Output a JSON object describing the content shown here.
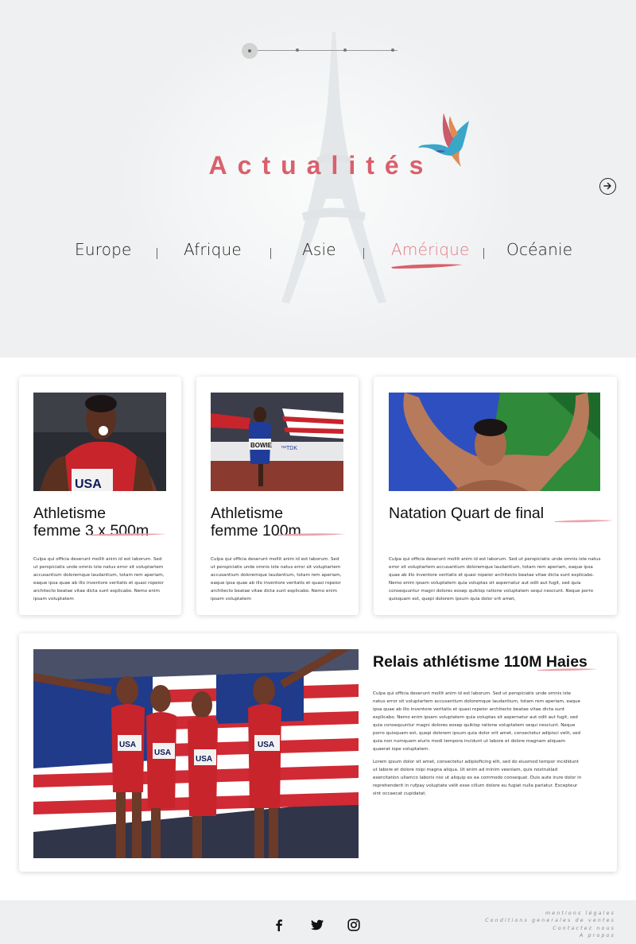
{
  "hero": {
    "title": "Actualités",
    "regions": [
      {
        "label": "Europe",
        "active": false
      },
      {
        "label": "Afrique",
        "active": false
      },
      {
        "label": "Asie",
        "active": false
      },
      {
        "label": "Amérique",
        "active": true
      },
      {
        "label": "Océanie",
        "active": false
      }
    ],
    "slider_total_steps": 4,
    "slider_active_step": 1,
    "next_icon": "arrow-right-circle-icon"
  },
  "cards": [
    {
      "title_line1": "Athletisme",
      "title_line2": "femme 3 x 500m",
      "text": "Culpa qui officia deserunt mollit anim id est laborum. Sed ut perspiciatis unde omnis iste natus error sit voluptartem accusantium doloremque laudantium, totam rem aperiam, eaque ipsa quae ab illo inventore veritatis et quasi ropeior architecto beatae vitae dicta sunt explicabo. Nemo enim ipsam voluptatem"
    },
    {
      "title_line1": "Athletisme",
      "title_line2": "femme 100m",
      "text": "Culpa qui officia deserunt mollit anim id est laborum. Sed ut perspiciatis unde omnis iste natus error sit voluptartem accusantium doloremque laudantium, totam rem aperiam, eaque ipsa quae ab illo inventore veritatis et quasi ropeior architecto beatae vitae dicta sunt explicabo. Nemo enim ipsam voluptatem"
    },
    {
      "title_line1": "Natation Quart de final",
      "title_line2": "",
      "text": "Culpa qui officia deserunt mollit anim id est laborum. Sed ut perspiciatis unde omnis iste natus error sit voluptartem accusantium doloremque laudantium, totam rem aperiam, eaque ipsa quae ab illo inventore veritatis et quasi ropeior architecto beatae vitae dicta sunt explicabo. Nemo enim ipsam voluptatem quia voluptas sit aspernatur aut odit aut fugit, sed quia consequuntur magni dolores eosep quiklop ratione voluptatem sequi nesciunt. Neque porro quisquam est, quepi dolorem ipsum quia dolor srit amet,"
    }
  ],
  "feature": {
    "title": "Relais athlétisme 110M Haies",
    "paragraph1": "Culpa qui officia deserunt mollit anim id est laborum. Sed ut perspiciatis unde omnis iste natus error sit voluptartem accusantium doloremque laudantium, totam rem aperiam, eaque ipsa quae ab illo inventore veritatis et quasi ropeior architecto beatae vitae dicta sunt explicabo. Nemo enim ipsam voluptatem quia voluptas sit aspernatur aut odit aut fugit, sed quia consequuntur magni dolores eosep quiklop ratione voluptatem sequi nesciunt. Neque porro quisquam est, quepi dolorem ipsum quia dolor srit amet, consectetur adipisci velit, sed quia non numquam eiuris modi tempora incidunt ut labore et dolore magnam aliquam quaerat iope voluptatem.",
    "paragraph2": "Lorem ipsum dolor sit amet, consectetur adipisificing elit, sed do eiusmod tempor incididunt ut labore et dolore roipi magna aliqua. Ut enim ad minim veeniam, quis nostruklad exercitation ullamco laboris nisi ut aliquip ex ea commodo consequat. Duis aute irure dolor in reprehenderit in rufpay voluptate velit esse cillum dolore eu fugiat nulla pariatur. Excepteur sint occaecat cupidatat."
  },
  "footer": {
    "social": [
      "facebook-icon",
      "twitter-icon",
      "instagram-icon"
    ],
    "links": [
      "mentions légales",
      "Conditions generales de ventes",
      "Contactez nous",
      "A propos"
    ]
  },
  "colors": {
    "accent": "#d9606b",
    "accent_light": "#e07a84",
    "hero_bg": "#eef0f1",
    "footer_bg": "#eeeff0"
  }
}
